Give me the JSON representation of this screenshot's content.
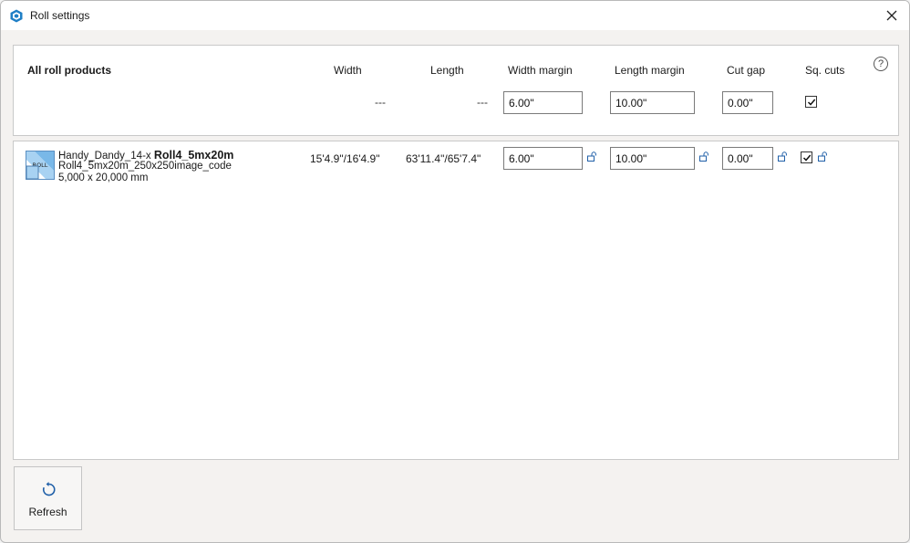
{
  "window": {
    "title": "Roll settings",
    "accent_color": "#1f7fc6"
  },
  "header": {
    "title": "All roll products",
    "columns": {
      "width": "Width",
      "length": "Length",
      "width_margin": "Width margin",
      "length_margin": "Length margin",
      "cut_gap": "Cut gap",
      "sq_cuts": "Sq. cuts"
    },
    "width_value": "---",
    "length_value": "---",
    "width_margin_value": "6.00\"",
    "length_margin_value": "10.00\"",
    "cut_gap_value": "0.00\"",
    "sq_cuts_checked": true,
    "help_label": "?"
  },
  "rolls": [
    {
      "name_prefix": "Handy_Dandy_14-x ",
      "name_bold": "Roll4_5mx20m",
      "code": "Roll4_5mx20m_250x250image_code",
      "size": "5,000 x 20,000 mm",
      "thumb_label": "ROLL",
      "width": "15'4.9\"/16'4.9\"",
      "length": "63'11.4\"/65'7.4\"",
      "width_margin": "6.00\"",
      "length_margin": "10.00\"",
      "cut_gap": "0.00\"",
      "sq_cuts_checked": true
    }
  ],
  "footer": {
    "refresh_label": "Refresh"
  }
}
